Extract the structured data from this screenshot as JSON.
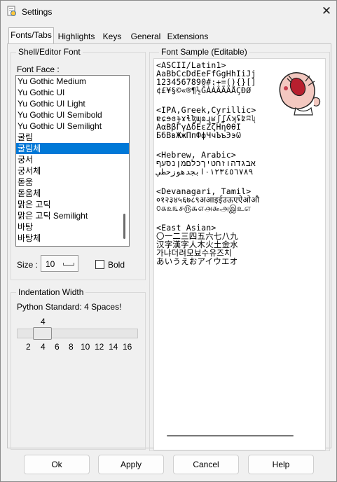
{
  "window": {
    "title": "Settings",
    "close_glyph": "✕",
    "icon": "python-settings-icon"
  },
  "tabs": [
    {
      "label": "Fonts/Tabs",
      "active": true
    },
    {
      "label": "Highlights"
    },
    {
      "label": "Keys"
    },
    {
      "label": "General"
    },
    {
      "label": "Extensions"
    }
  ],
  "shell_font": {
    "group_label": "Shell/Editor Font",
    "face_label": "Font Face :",
    "faces": [
      "Yu Gothic Medium",
      "Yu Gothic UI",
      "Yu Gothic UI Light",
      "Yu Gothic UI Semibold",
      "Yu Gothic UI Semilight",
      "굴림",
      "굴림체",
      "궁서",
      "궁서체",
      "돋움",
      "돋움체",
      "맑은 고딕",
      "맑은 고딕 Semilight",
      "바탕",
      "바탕체"
    ],
    "selected_face": "굴림체",
    "size_label": "Size :",
    "size_value": "10",
    "bold_label": "Bold",
    "bold_checked": false
  },
  "indentation": {
    "group_label": "Indentation Width",
    "standard_label": "Python Standard: 4 Spaces!",
    "value": "4",
    "ticks": [
      "2",
      "4",
      "6",
      "8",
      "10",
      "12",
      "14",
      "16"
    ]
  },
  "sample": {
    "group_label": "Font Sample (Editable)",
    "lines": [
      "<ASCII/Latin1>",
      "AaBbCcDdEeFfGgHhIiJj",
      "1234567890#:+=(){}[]",
      "¢£¥§©«®¶½ĞÀÁÂÃÄÅÇÐØ",
      "",
      "<IPA,Greek,Cyrillic>",
      "ɐɕɘɞɟɤɬɮɰɷɻʁʃʆʎʞʢʫʭʯ",
      "ΑαΒβΓγΔδΕεΖζΗηΘθΙ",
      "БбВвЖжПпФфЧчЪъЭэѠ",
      "",
      "<Hebrew, Arabic>",
      "אבגדהוזחטיךכלםמןנסעף",
      "٠١٢٣٤٥٦٧٨٩ابجدهوزحطي",
      "",
      "<Devanagari, Tamil>",
      "०१२३४५६७८९अआइईउऊएऐओऔ",
      "௦௧௨௩௪௫௬௭௮௯அஇஉஎ",
      "",
      "<East Asian>",
      "〇一二三四五六七八九",
      "汉字漢字人木火土金水",
      "가냐더려모뵤수유즈치",
      "あいうえおアイウエオ"
    ]
  },
  "buttons": {
    "ok": "Ok",
    "apply": "Apply",
    "cancel": "Cancel",
    "help": "Help"
  }
}
